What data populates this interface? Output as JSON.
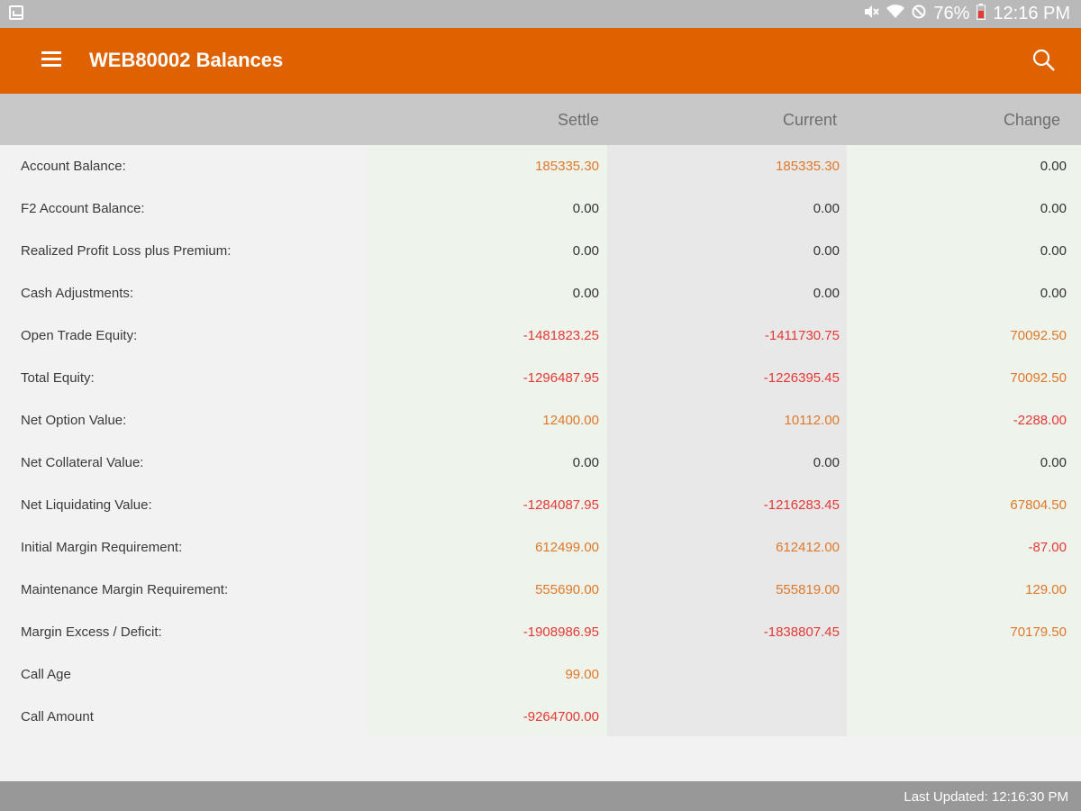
{
  "status_bar": {
    "battery": "76%",
    "time": "12:16 PM"
  },
  "app_bar": {
    "title": "WEB80002 Balances"
  },
  "columns": {
    "settle": "Settle",
    "current": "Current",
    "change": "Change"
  },
  "rows": [
    {
      "label": "Account Balance:",
      "settle": "185335.30",
      "current": "185335.30",
      "change": "0.00",
      "colors": [
        "orange",
        "orange",
        "dark"
      ]
    },
    {
      "label": "F2 Account Balance:",
      "settle": "0.00",
      "current": "0.00",
      "change": "0.00",
      "colors": [
        "dark",
        "dark",
        "dark"
      ]
    },
    {
      "label": "Realized Profit Loss plus Premium:",
      "settle": "0.00",
      "current": "0.00",
      "change": "0.00",
      "colors": [
        "dark",
        "dark",
        "dark"
      ]
    },
    {
      "label": "Cash Adjustments:",
      "settle": "0.00",
      "current": "0.00",
      "change": "0.00",
      "colors": [
        "dark",
        "dark",
        "dark"
      ]
    },
    {
      "label": "Open Trade Equity:",
      "settle": "-1481823.25",
      "current": "-1411730.75",
      "change": "70092.50",
      "colors": [
        "red",
        "red",
        "orange"
      ]
    },
    {
      "label": "Total Equity:",
      "settle": "-1296487.95",
      "current": "-1226395.45",
      "change": "70092.50",
      "colors": [
        "red",
        "red",
        "orange"
      ]
    },
    {
      "label": "Net Option Value:",
      "settle": "12400.00",
      "current": "10112.00",
      "change": "-2288.00",
      "colors": [
        "orange",
        "orange",
        "red"
      ]
    },
    {
      "label": "Net Collateral Value:",
      "settle": "0.00",
      "current": "0.00",
      "change": "0.00",
      "colors": [
        "dark",
        "dark",
        "dark"
      ]
    },
    {
      "label": "Net Liquidating Value:",
      "settle": "-1284087.95",
      "current": "-1216283.45",
      "change": "67804.50",
      "colors": [
        "red",
        "red",
        "orange"
      ]
    },
    {
      "label": "Initial Margin Requirement:",
      "settle": "612499.00",
      "current": "612412.00",
      "change": "-87.00",
      "colors": [
        "orange",
        "orange",
        "red"
      ]
    },
    {
      "label": "Maintenance Margin Requirement:",
      "settle": "555690.00",
      "current": "555819.00",
      "change": "129.00",
      "colors": [
        "orange",
        "orange",
        "orange"
      ]
    },
    {
      "label": "Margin Excess / Deficit:",
      "settle": "-1908986.95",
      "current": "-1838807.45",
      "change": "70179.50",
      "colors": [
        "red",
        "red",
        "orange"
      ]
    },
    {
      "label": "Call Age",
      "settle": "99.00",
      "current": "",
      "change": "",
      "colors": [
        "orange",
        "dark",
        "dark"
      ]
    },
    {
      "label": "Call Amount",
      "settle": "-9264700.00",
      "current": "",
      "change": "",
      "colors": [
        "red",
        "dark",
        "dark"
      ]
    }
  ],
  "footer": {
    "last_updated": "Last Updated: 12:16:30 PM"
  },
  "colors": {
    "app_bar": "#e06100",
    "positive": "#e0782a",
    "negative": "#e53935"
  },
  "icons": [
    "image-icon",
    "mute-icon",
    "wifi-icon",
    "blocked-icon",
    "battery-icon",
    "menu-icon",
    "search-icon"
  ]
}
